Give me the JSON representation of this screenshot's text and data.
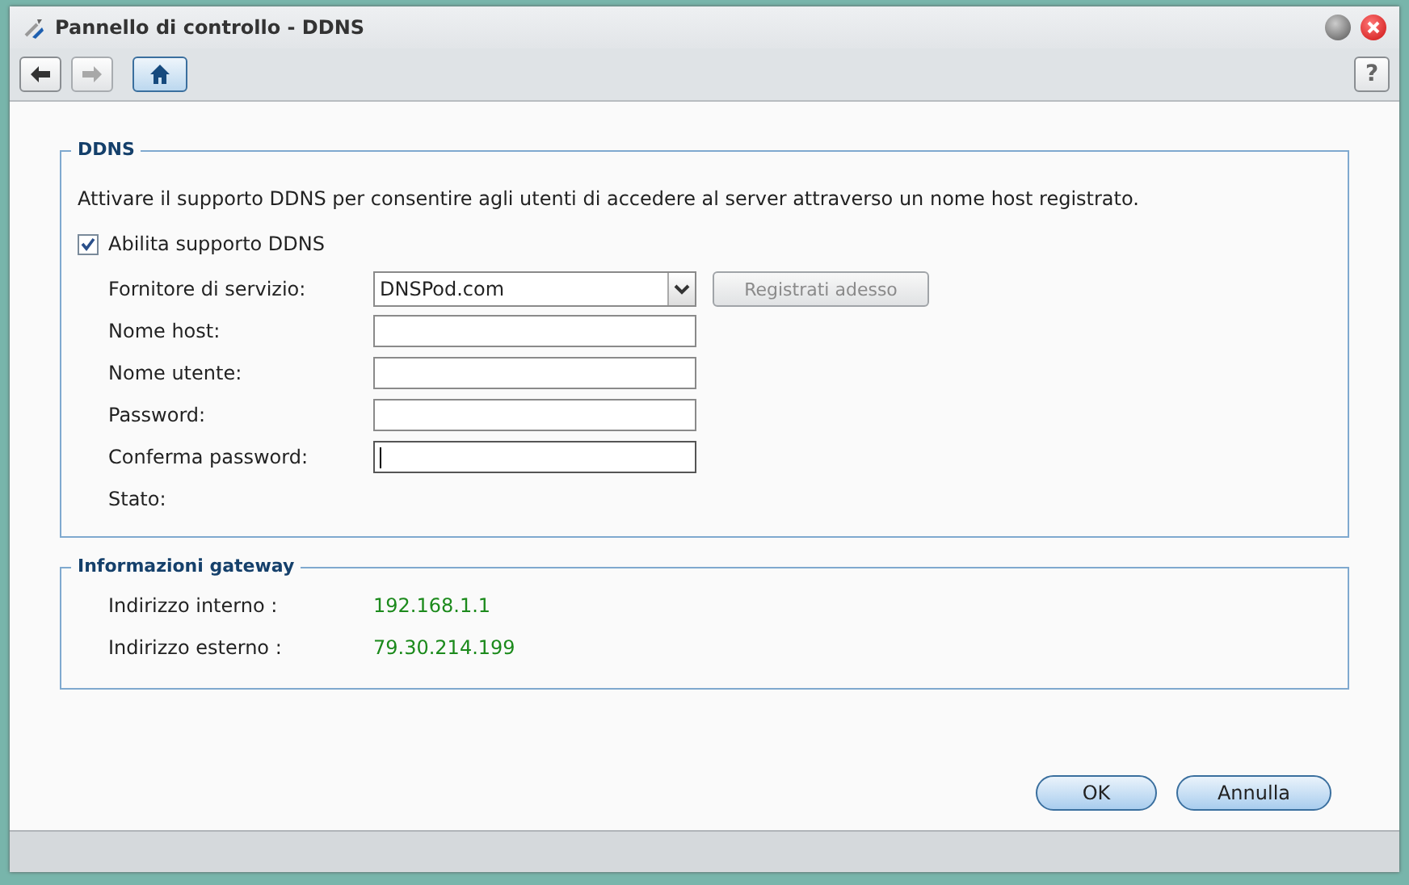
{
  "window": {
    "title": "Pannello di controllo - DDNS"
  },
  "toolbar": {
    "back": {
      "disabled": false
    },
    "forward": {
      "disabled": true
    },
    "help": "?"
  },
  "ddns": {
    "legend": "DDNS",
    "description": "Attivare il supporto DDNS per consentire agli utenti di accedere al server attraverso un nome host registrato.",
    "enable": {
      "label": "Abilita supporto DDNS",
      "checked": true
    },
    "fields": [
      {
        "kind": "select",
        "label": "Fornitore di servizio:",
        "value": "DNSPod.com"
      },
      {
        "kind": "text",
        "label": "Nome host:",
        "focused": false
      },
      {
        "kind": "text",
        "label": "Nome utente:",
        "focused": false
      },
      {
        "kind": "text",
        "label": "Password:",
        "focused": false
      },
      {
        "kind": "text",
        "label": "Conferma password:",
        "focused": true
      },
      {
        "kind": "status",
        "label": "Stato:"
      }
    ],
    "register_button": {
      "label": "Registrati adesso",
      "disabled": true
    }
  },
  "gateway": {
    "legend": "Informazioni gateway",
    "rows": [
      {
        "label": "Indirizzo interno :",
        "value": "192.168.1.1"
      },
      {
        "label": "Indirizzo esterno :",
        "value": "79.30.214.199"
      }
    ]
  },
  "buttons": [
    {
      "label": "OK"
    },
    {
      "label": "Annulla"
    }
  ]
}
